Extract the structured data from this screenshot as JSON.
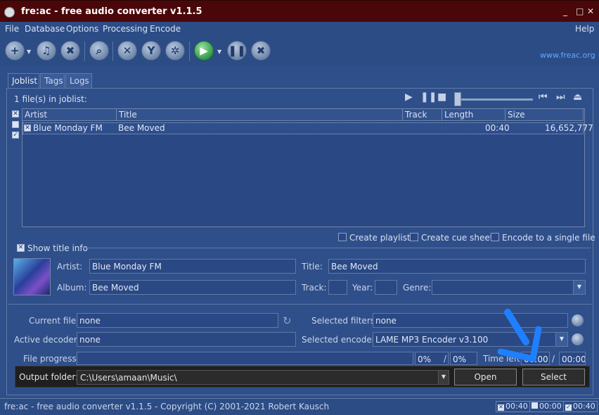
{
  "window": {
    "title": "fre:ac - free audio converter v1.1.5",
    "controls": [
      "_",
      "□",
      "✕"
    ]
  },
  "menu": [
    "File",
    "Database",
    "Options",
    "Processing",
    "Encode"
  ],
  "help": "Help",
  "site_link": "www.freac.org",
  "tabs": [
    "Joblist",
    "Tags",
    "Logs"
  ],
  "joblist": {
    "count": "1 file(s) in joblist:",
    "columns": [
      "Artist",
      "Title",
      "Track",
      "Length",
      "Size"
    ],
    "rows": [
      {
        "artist": "Blue Monday FM",
        "title": "Bee Moved",
        "track": "",
        "length": "00:40",
        "size": "16,652,777"
      }
    ]
  },
  "options": {
    "create_playlist": "Create playlist",
    "create_cue": "Create cue sheet",
    "single_file": "Encode to a single file"
  },
  "title_info": {
    "toggle": "Show title info",
    "artist_label": "Artist:",
    "artist": "Blue Monday FM",
    "title_label": "Title:",
    "title": "Bee Moved",
    "album_label": "Album:",
    "album": "Bee Moved",
    "track_label": "Track:",
    "year_label": "Year:",
    "genre_label": "Genre:"
  },
  "status": {
    "current_file_label": "Current file:",
    "current_file": "none",
    "active_decoder_label": "Active decoder:",
    "active_decoder": "none",
    "file_progress_label": "File progress:",
    "file_progress_pct": "0%",
    "total_progress_pct": "0%",
    "slash": "/",
    "selected_filters_label": "Selected filters:",
    "selected_filters": "none",
    "selected_encoder_label": "Selected encoder:",
    "selected_encoder": "LAME MP3 Encoder v3.100",
    "time_left_label": "Time left:",
    "time_left": "00:00",
    "time_total": "00:00"
  },
  "output": {
    "label": "Output folder:",
    "path": "C:\\Users\\amaan\\Music\\",
    "open": "Open",
    "select": "Select"
  },
  "statusbar": {
    "text": "fre:ac - free audio converter v1.1.5 - Copyright (C) 2001-2021 Robert Kausch",
    "t1": "00:40",
    "t2": "00:00",
    "t3": "00:40"
  }
}
